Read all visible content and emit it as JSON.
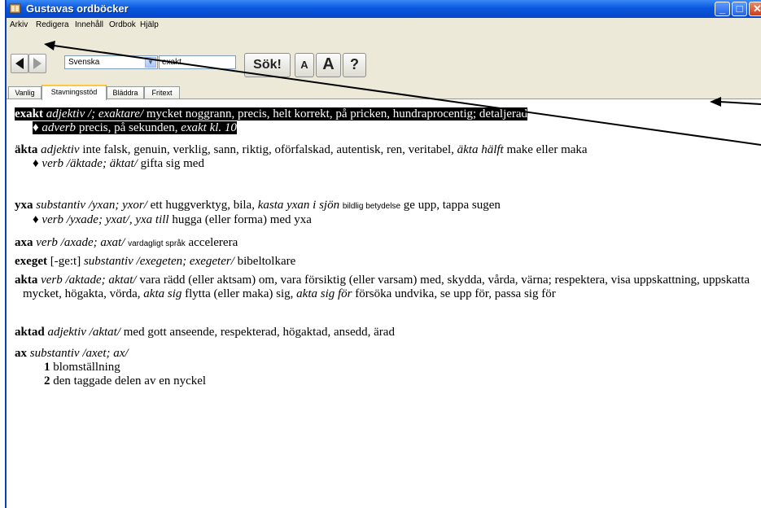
{
  "window": {
    "title": "Gustavas ordböcker"
  },
  "menu": [
    "Arkiv",
    "Redigera",
    "Innehåll",
    "Ordbok",
    "Hjälp"
  ],
  "toolbar": {
    "language": "Svenska",
    "search_value": "exakt",
    "search_label": "Sök!",
    "font_small": "A",
    "font_large": "A",
    "help": "?"
  },
  "tabs": [
    "Vanlig",
    "Stavningsstöd",
    "Bläddra",
    "Fritext"
  ],
  "active_tab": "Stavningsstöd",
  "entries": {
    "exakt": {
      "hw": "exakt",
      "pos": "adjektiv /; exaktare/",
      "def": " mycket noggrann, precis, helt korrekt, på pricken, hundraprocentig; detaljerad",
      "sub_pos": "adverb",
      "sub_def": " precis, på sekunden, ",
      "sub_ex": "exakt kl. 10"
    },
    "akta_adj": {
      "hw": "äkta",
      "pos": "adjektiv",
      "def": " inte falsk, genuin, verklig, sann, riktig, oförfalskad, autentisk, ren, veritabel, ",
      "ex": "äkta hälft",
      "def2": " make eller maka",
      "sub_pos": "verb /äktade; äktat/",
      "sub_def": " gifta sig med"
    },
    "yxa": {
      "hw": "yxa",
      "pos": "substantiv /yxan; yxor/",
      "def": " ett huggverktyg, bila, ",
      "ex": "kasta yxan i sjön",
      "note": "bildlig betydelse",
      "def2": " ge upp, tappa sugen",
      "sub_pos": "verb /yxade; yxat/, yxa till",
      "sub_def": " hugga (eller forma) med yxa"
    },
    "axa": {
      "hw": "axa",
      "pos": "verb /axade; axat/",
      "note": "vardagligt språk",
      "def": " accelerera"
    },
    "exeget": {
      "hw": "exeget",
      "pron": " [-ge:t] ",
      "pos": "substantiv /exegeten; exegeter/",
      "def": " bibeltolkare"
    },
    "akta_verb": {
      "hw": "akta",
      "pos": "verb /aktade; aktat/",
      "def": " vara rädd (eller aktsam) om, vara försiktig (eller varsam) med, skydda, vårda, värna; respektera, visa uppskattning, uppskatta mycket, högakta, vörda, ",
      "ex": "akta sig",
      "def2": " flytta (eller maka) sig, ",
      "ex2": "akta sig för",
      "def3": " försöka undvika, se upp för, passa sig för"
    },
    "aktad": {
      "hw": "aktad",
      "pos": "adjektiv /aktat/",
      "def": " med gott anseende, respekterad, högaktad, ansedd, ärad"
    },
    "ax": {
      "hw": "ax",
      "pos": "substantiv /axet; ax/",
      "senses": [
        {
          "num": "1",
          "text": " blomställning"
        },
        {
          "num": "2",
          "text": " den taggade delen av en nyckel"
        }
      ]
    }
  }
}
